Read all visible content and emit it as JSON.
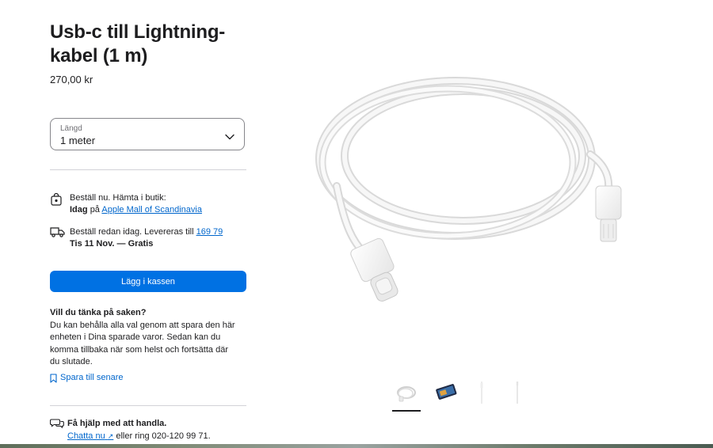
{
  "product": {
    "title": "Usb-c till Lightning-kabel (1 m)",
    "price": "270,00 kr"
  },
  "length_select": {
    "label": "Längd",
    "value": "1 meter"
  },
  "pickup": {
    "line1": "Beställ nu. Hämta i butik:",
    "day": "Idag",
    "at": "på",
    "store_link": "Apple Mall of Scandinavia"
  },
  "delivery": {
    "line1": "Beställ redan idag.  Levereras till",
    "zip_link": "169 79",
    "line2": "Tis 11 Nov. — Gratis"
  },
  "add_to_bag": "Lägg i kassen",
  "think": {
    "heading": "Vill du tänka på saken?",
    "body": "Du kan behålla alla val genom att spara den här enheten i Dina sparade varor. Sedan kan du komma tillbaka när som helst och fortsätta där du slutade.",
    "save_link": "Spara till senare"
  },
  "help": {
    "heading": "Få hjälp med att handla.",
    "chat_link": "Chatta nu",
    "chat_arrow": "↗",
    "rest": "eller ring 020-120 99 71."
  },
  "icons": {
    "select_chevron": "chevron-down-icon",
    "pickup": "shopping-bag-icon",
    "delivery": "shipping-truck-icon",
    "save": "bookmark-icon",
    "help": "chat-bubbles-icon"
  },
  "colors": {
    "accent": "#0071e3",
    "link": "#0066cc",
    "text": "#1d1d1f",
    "divider": "#d2d2d7"
  }
}
